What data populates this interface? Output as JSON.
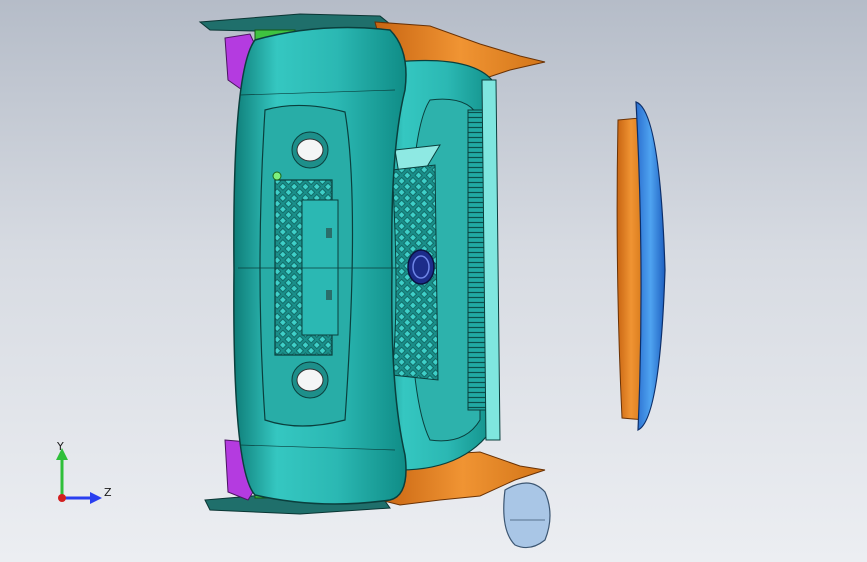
{
  "viewport": {
    "background_top": "#b5bcc8",
    "background_bottom": "#eceef2"
  },
  "model": {
    "bumper_color": "#2bb8b3",
    "bumper_shade": "#127f7a",
    "bracket_color": "#e07c20",
    "fascia_color": "#2f8be0",
    "clip_color": "#b43be0",
    "tab_color": "#3fc33f",
    "emblem_color": "#1c2c8a",
    "mirror_color": "#a9c6e6"
  },
  "triad": {
    "y_label": "Y",
    "z_label": "Z",
    "y_color": "#2fbf3a",
    "z_color": "#2a3ff0",
    "origin_color": "#d21f1f"
  }
}
